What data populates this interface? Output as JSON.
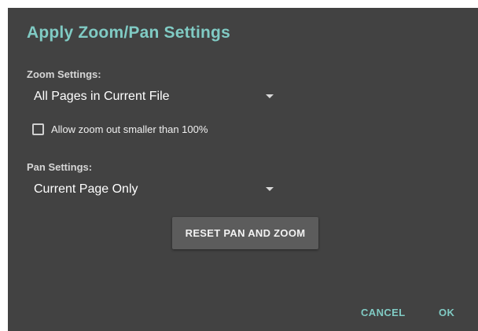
{
  "dialog": {
    "title": "Apply Zoom/Pan Settings",
    "accent_color": "#80cbc4",
    "background_color": "#424242"
  },
  "zoom": {
    "label": "Zoom Settings:",
    "selected": "All Pages in Current File",
    "allow_zoom_out_label": "Allow zoom out smaller than 100%",
    "allow_zoom_out_checked": false
  },
  "pan": {
    "label": "Pan Settings:",
    "selected": "Current Page Only"
  },
  "reset_button_label": "RESET PAN AND ZOOM",
  "actions": {
    "cancel_label": "CANCEL",
    "ok_label": "OK"
  },
  "icons": {
    "dropdown": "caret-down-icon",
    "checkbox": "checkbox-unchecked-icon"
  }
}
